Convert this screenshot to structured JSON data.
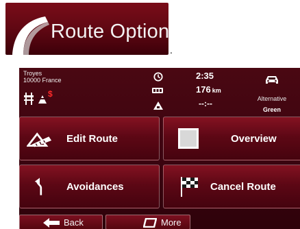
{
  "title": {
    "text": "Route Options",
    "trailing": "."
  },
  "status": {
    "location_line1": "Troyes",
    "location_line2": "10000 France",
    "time": "2:35",
    "distance": "176",
    "distance_unit": "km",
    "eta": "--:--",
    "route_type": "Alternative",
    "route_sub": "Green",
    "restriction_mark": "$"
  },
  "buttons": {
    "edit_route": "Edit Route",
    "overview": "Overview",
    "avoidances": "Avoidances",
    "cancel_route": "Cancel Route"
  },
  "footer": {
    "back": "Back",
    "more": "More"
  },
  "icons": {
    "title": "road-swoosh-icon",
    "road_restrictions": [
      "highway-icon",
      "toll-road-icon"
    ],
    "time": "clock-icon",
    "distance": "distance-icon",
    "eta": "warning-icon",
    "vehicle": "car-icon",
    "edit": "ruler-triangle-icon",
    "overview": "overview-square-icon",
    "avoid": "detour-arrow-icon",
    "cancel": "checkered-flag-icon",
    "back": "arrow-left-icon",
    "more": "more-icon"
  },
  "colors": {
    "background": "#3d0410",
    "banner": "#6a0a16",
    "button_border": "#b98a90",
    "text": "#ffffff",
    "restriction": "#ff2a2a"
  }
}
